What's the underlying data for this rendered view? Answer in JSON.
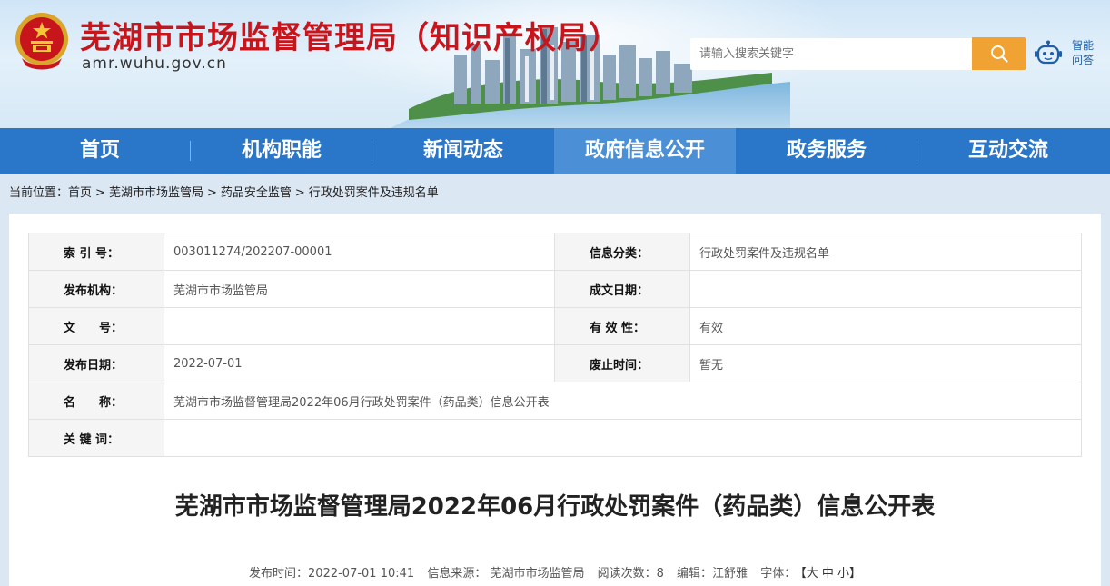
{
  "header": {
    "site_title": "芜湖市市场监督管理局（知识产权局）",
    "domain": "amr.wuhu.gov.cn",
    "search_placeholder": "请输入搜索关键字",
    "assistant_label": "智能问答"
  },
  "nav": {
    "items": [
      {
        "label": "首页"
      },
      {
        "label": "机构职能"
      },
      {
        "label": "新闻动态"
      },
      {
        "label": "政府信息公开"
      },
      {
        "label": "政务服务"
      },
      {
        "label": "互动交流"
      }
    ],
    "active_index": 3
  },
  "breadcrumb": {
    "prefix": "当前位置：",
    "items": [
      "首页",
      "芜湖市市场监管局",
      "药品安全监管",
      "行政处罚案件及违规名单"
    ],
    "separator": ">"
  },
  "meta": {
    "index_label": "索 引 号：",
    "index_value": "003011274/202207-00001",
    "category_label": "信息分类：",
    "category_value": "行政处罚案件及违规名单",
    "publisher_label": "发布机构：",
    "publisher_value": "芜湖市市场监管局",
    "created_label": "成文日期：",
    "created_value": "",
    "docno_label": "文　　号：",
    "docno_value": "",
    "validity_label": "有 效 性：",
    "validity_value": "有效",
    "pubdate_label": "发布日期：",
    "pubdate_value": "2022-07-01",
    "expire_label": "废止时间：",
    "expire_value": "暂无",
    "name_label": "名　　称：",
    "name_value": "芜湖市市场监督管理局2022年06月行政处罚案件（药品类）信息公开表",
    "keywords_label": "关 键 词：",
    "keywords_value": ""
  },
  "document": {
    "title": "芜湖市市场监督管理局2022年06月行政处罚案件（药品类）信息公开表",
    "publish_time": "发布时间：2022-07-01 10:41",
    "source": "信息来源： 芜湖市市场监管局",
    "views": "阅读次数：8",
    "editor": "编辑：江舒雅",
    "font_size_label": "字体：",
    "font_size_options": "【大 中 小】"
  },
  "colors": {
    "title_red": "#c8141b",
    "nav_blue": "#2a76c8",
    "nav_active": "#4b8fd6",
    "search_orange": "#f0a233"
  }
}
